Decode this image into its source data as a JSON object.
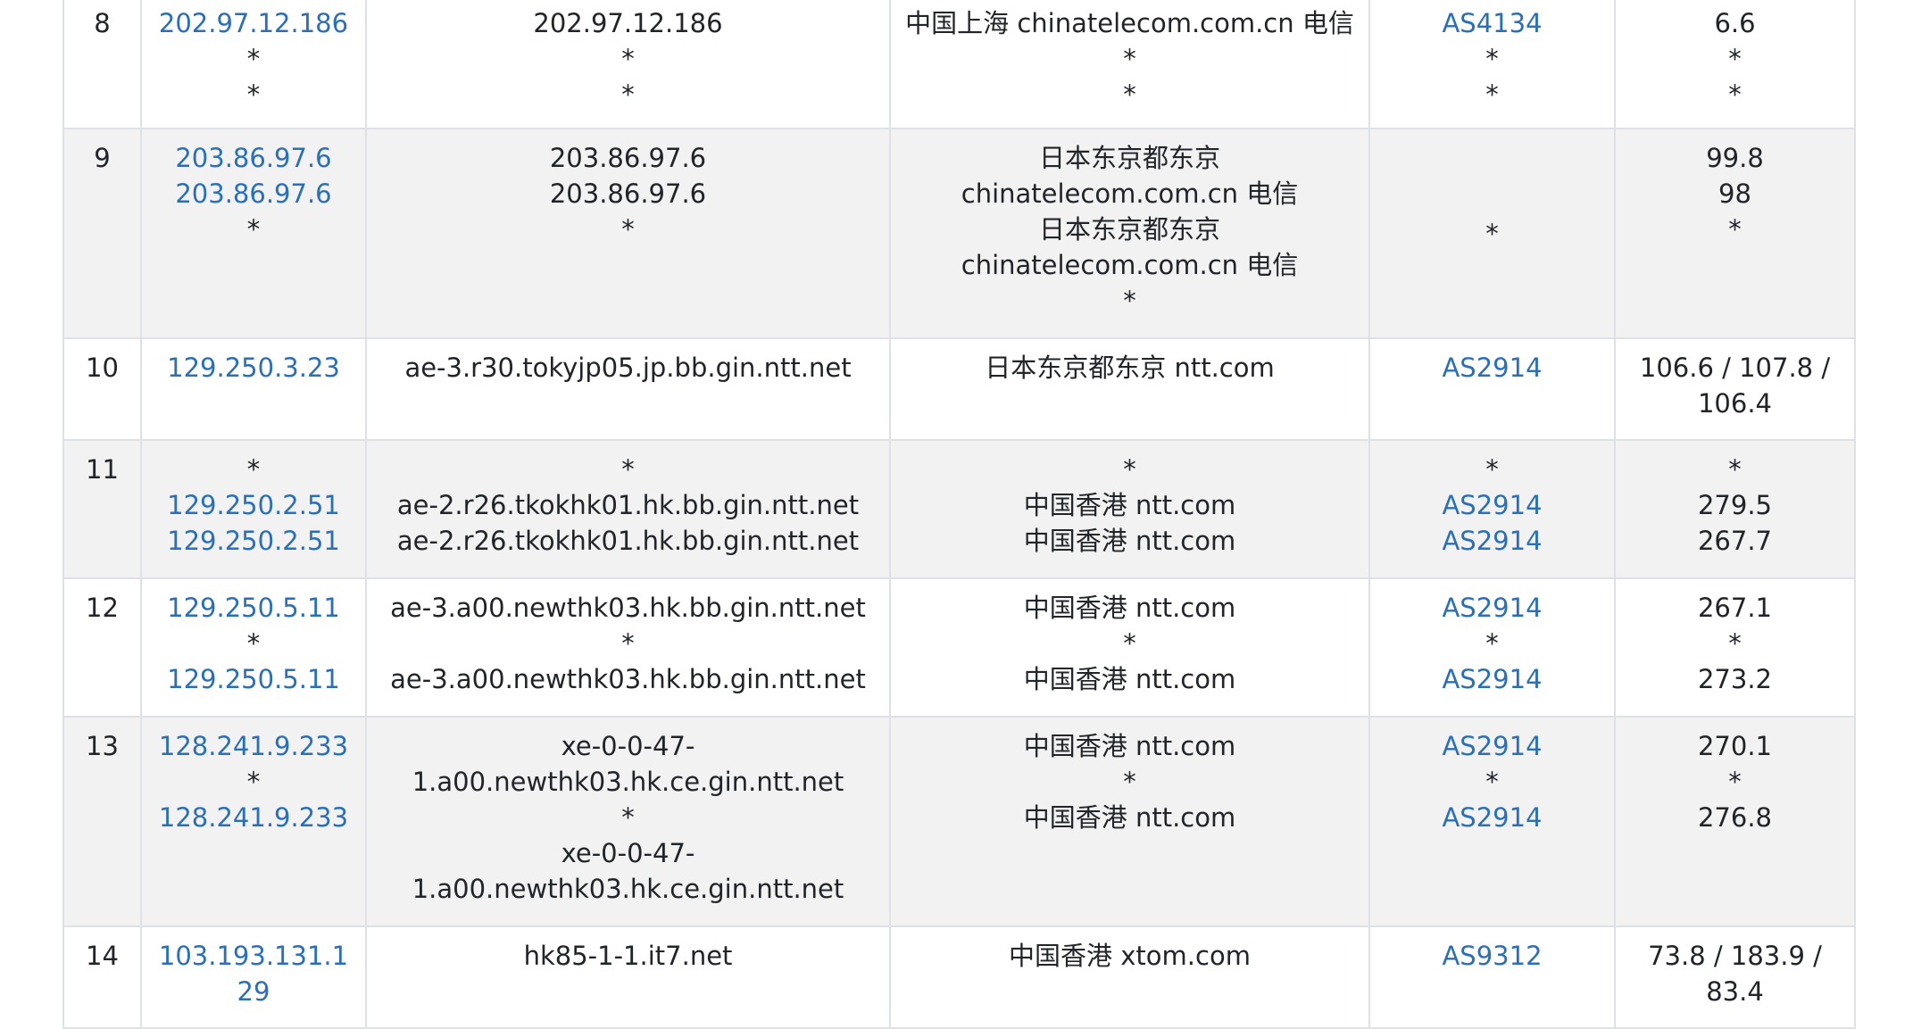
{
  "rows": [
    {
      "hop": "8",
      "ips": [
        "202.97.12.186",
        "*",
        "*"
      ],
      "hosts": [
        "202.97.12.186",
        "*",
        "*"
      ],
      "locations": [
        "中国上海 chinatelecom.com.cn 电信",
        "*",
        "*"
      ],
      "asns": [
        "AS4134",
        "*",
        "*"
      ],
      "times": [
        "6.6",
        "*",
        "*"
      ]
    },
    {
      "hop": "9",
      "ips": [
        "203.86.97.6",
        "203.86.97.6",
        "*"
      ],
      "hosts": [
        "203.86.97.6",
        "203.86.97.6",
        "*"
      ],
      "locations": [
        "日本东京都东京 chinatelecom.com.cn 电信",
        "日本东京都东京 chinatelecom.com.cn 电信",
        "*"
      ],
      "asns": [
        "*"
      ],
      "times": [
        "99.8",
        "98",
        "*"
      ]
    },
    {
      "hop": "10",
      "ips": [
        "129.250.3.23"
      ],
      "hosts": [
        "ae-3.r30.tokyjp05.jp.bb.gin.ntt.net"
      ],
      "locations": [
        "日本东京都东京 ntt.com"
      ],
      "asns": [
        "AS2914"
      ],
      "times": [
        "106.6 / 107.8 / 106.4"
      ]
    },
    {
      "hop": "11",
      "ips": [
        "*",
        "129.250.2.51",
        "129.250.2.51"
      ],
      "hosts": [
        "*",
        "ae-2.r26.tkokhk01.hk.bb.gin.ntt.net",
        "ae-2.r26.tkokhk01.hk.bb.gin.ntt.net"
      ],
      "locations": [
        "*",
        "中国香港 ntt.com",
        "中国香港 ntt.com"
      ],
      "asns": [
        "*",
        "AS2914",
        "AS2914"
      ],
      "times": [
        "*",
        "279.5",
        "267.7"
      ]
    },
    {
      "hop": "12",
      "ips": [
        "129.250.5.11",
        "*",
        "129.250.5.11"
      ],
      "hosts": [
        "ae-3.a00.newthk03.hk.bb.gin.ntt.net",
        "*",
        "ae-3.a00.newthk03.hk.bb.gin.ntt.net"
      ],
      "locations": [
        "中国香港 ntt.com",
        "*",
        "中国香港 ntt.com"
      ],
      "asns": [
        "AS2914",
        "*",
        "AS2914"
      ],
      "times": [
        "267.1",
        "*",
        "273.2"
      ]
    },
    {
      "hop": "13",
      "ips": [
        "128.241.9.233",
        "*",
        "128.241.9.233"
      ],
      "hosts": [
        "xe-0-0-47-1.a00.newthk03.hk.ce.gin.ntt.net",
        "*",
        "xe-0-0-47-1.a00.newthk03.hk.ce.gin.ntt.net"
      ],
      "locations": [
        "中国香港 ntt.com",
        "*",
        "中国香港 ntt.com"
      ],
      "asns": [
        "AS2914",
        "*",
        "AS2914"
      ],
      "times": [
        "270.1",
        "*",
        "276.8"
      ]
    },
    {
      "hop": "14",
      "ips": [
        "103.193.131.129"
      ],
      "hosts": [
        "hk85-1-1.it7.net"
      ],
      "locations": [
        "中国香港 xtom.com"
      ],
      "asns": [
        "AS9312"
      ],
      "times": [
        "73.8 / 183.9 / 83.4"
      ]
    }
  ],
  "colors": {
    "link": "#2a6fb7",
    "border": "#dee2e6",
    "stripe": "#f2f2f2",
    "text": "#212529"
  }
}
